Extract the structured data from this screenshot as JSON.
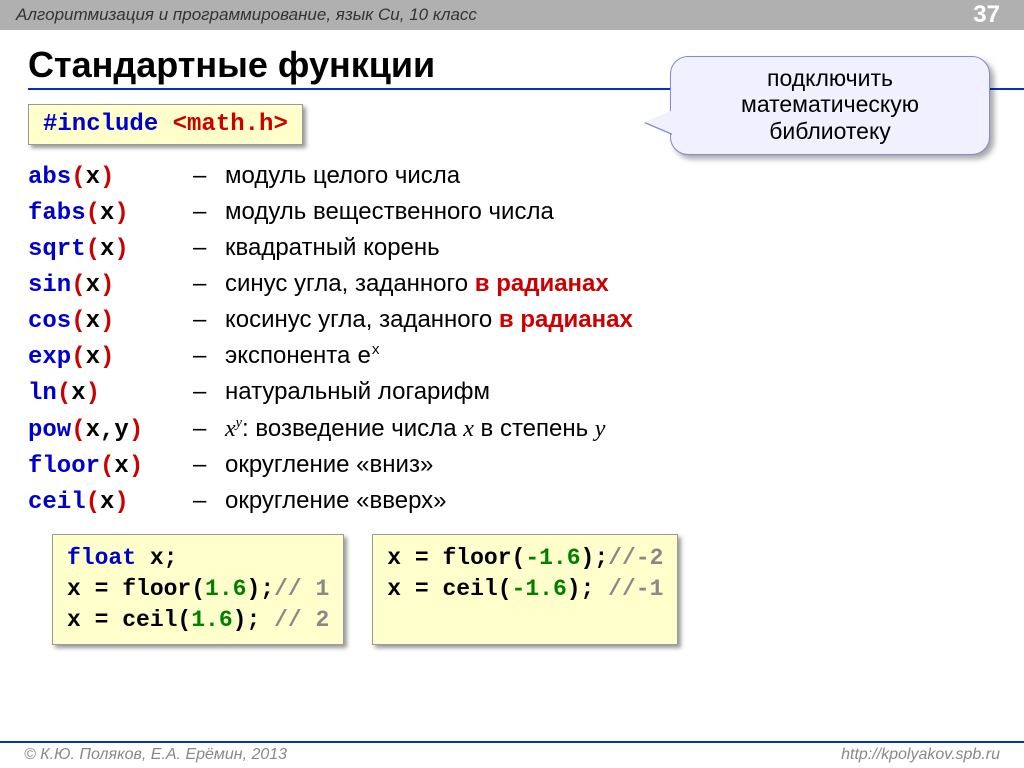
{
  "header": {
    "course": "Алгоритмизация и программирование, язык Си, 10 класс",
    "page": "37"
  },
  "title": "Стандартные функции",
  "include_box": {
    "kw": "#include",
    "hdr": "<math.h>"
  },
  "callout": "подключить математическую библиотеку",
  "functions": [
    {
      "name": "abs",
      "args": "(x)",
      "desc": "модуль целого числа"
    },
    {
      "name": "fabs",
      "args": "(x)",
      "desc": "модуль вещественного числа"
    },
    {
      "name": "sqrt",
      "args": "(x)",
      "desc": "квадратный корень"
    },
    {
      "name": "sin",
      "args": "(x)",
      "desc": "синус угла, заданного ",
      "highlight": "в радианах"
    },
    {
      "name": "cos",
      "args": "(x)",
      "desc": "косинус угла, заданного ",
      "highlight": "в радианах"
    },
    {
      "name": "exp",
      "args": "(x)",
      "desc": "экспонента ",
      "mono_base": "e",
      "mono_sup": "x"
    },
    {
      "name": "ln",
      "args": "(x)",
      "desc": "натуральный логарифм"
    },
    {
      "name": "pow",
      "args": "(x,y)",
      "ital_base": "x",
      "ital_sup": "y",
      "desc_after": ": возведение числа ",
      "ital2": "x",
      "desc_after2": " в степень ",
      "ital3": "y"
    },
    {
      "name": "floor",
      "args": "(x)",
      "desc": "округление «вниз»"
    },
    {
      "name": "ceil",
      "args": "(x)",
      "desc": "округление «вверх»"
    }
  ],
  "example_left": {
    "l1_kw": "float",
    "l1_rest": " x;",
    "l2_pre": "x = floor(",
    "l2_num": "1.6",
    "l2_post": ");",
    "l2_cmt": "// 1",
    "l3_pre": "x = ceil(",
    "l3_num": "1.6",
    "l3_post": "); ",
    "l3_cmt": "// 2"
  },
  "example_right": {
    "l1_pre": "x = floor(",
    "l1_num": "-1.6",
    "l1_post": ");",
    "l1_cmt": "//-2",
    "l2_pre": "x = ceil(",
    "l2_num": "-1.6",
    "l2_post": "); ",
    "l2_cmt": "//-1"
  },
  "footer": {
    "left": "© К.Ю. Поляков, Е.А. Ерёмин, 2013",
    "right": "http://kpolyakov.spb.ru"
  }
}
